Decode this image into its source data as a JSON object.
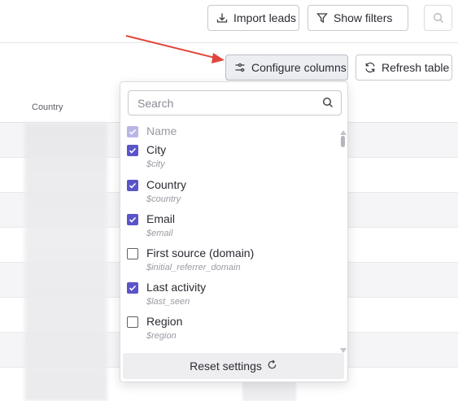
{
  "toolbar": {
    "import_label": "Import leads",
    "filters_label": "Show filters",
    "configure_label": "Configure columns",
    "refresh_label": "Refresh table"
  },
  "table": {
    "column_header": "Country"
  },
  "column_picker": {
    "search_placeholder": "Search",
    "items": [
      {
        "label": "Name",
        "sub": "",
        "checked": true,
        "disabled": true
      },
      {
        "label": "City",
        "sub": "$city",
        "checked": true,
        "disabled": false
      },
      {
        "label": "Country",
        "sub": "$country",
        "checked": true,
        "disabled": false
      },
      {
        "label": "Email",
        "sub": "$email",
        "checked": true,
        "disabled": false
      },
      {
        "label": "First source (domain)",
        "sub": "$initial_referrer_domain",
        "checked": false,
        "disabled": false
      },
      {
        "label": "Last activity",
        "sub": "$last_seen",
        "checked": true,
        "disabled": false
      },
      {
        "label": "Region",
        "sub": "$region",
        "checked": false,
        "disabled": false
      }
    ],
    "reset_label": "Reset settings"
  },
  "colors": {
    "accent": "#5b54c9",
    "annotation_arrow": "#e0463b",
    "filter_dot": "#5b54c9"
  }
}
